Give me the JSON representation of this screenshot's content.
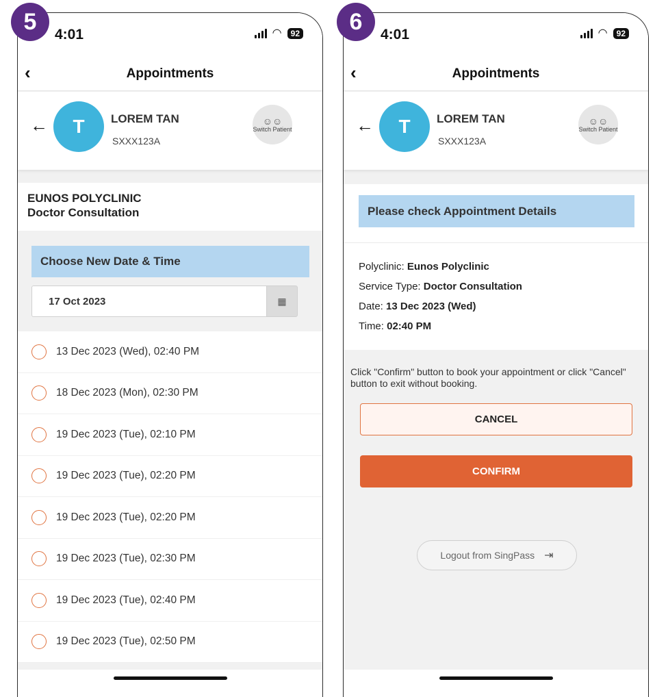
{
  "screens": [
    {
      "step": "5",
      "status": {
        "time": "4:01",
        "battery": "92"
      },
      "nav": {
        "title": "Appointments"
      },
      "patient": {
        "initial": "T",
        "name": "LOREM TAN",
        "id": "SXXX123A",
        "switch_label": "Switch Patient"
      },
      "clinic": {
        "name": "EUNOS POLYCLINIC",
        "service": "Doctor Consultation"
      },
      "choose": {
        "title": "Choose New Date & Time",
        "date_value": "17 Oct 2023"
      },
      "slots": [
        "13 Dec 2023 (Wed), 02:40 PM",
        "18 Dec 2023 (Mon), 02:30 PM",
        "19 Dec 2023 (Tue), 02:10 PM",
        "19 Dec 2023 (Tue), 02:20 PM",
        "19 Dec 2023 (Tue), 02:20 PM",
        "19 Dec 2023 (Tue), 02:30 PM",
        "19 Dec 2023 (Tue), 02:40 PM",
        "19 Dec 2023 (Tue), 02:50 PM"
      ]
    },
    {
      "step": "6",
      "status": {
        "time": "4:01",
        "battery": "92"
      },
      "nav": {
        "title": "Appointments"
      },
      "patient": {
        "initial": "T",
        "name": "LOREM TAN",
        "id": "SXXX123A",
        "switch_label": "Switch Patient"
      },
      "details": {
        "title": "Please check Appointment Details",
        "polyclinic_label": "Polyclinic:",
        "polyclinic_value": "Eunos Polyclinic",
        "service_label": "Service Type:",
        "service_value": "Doctor Consultation",
        "date_label": "Date:",
        "date_value": "13 Dec 2023 (Wed)",
        "time_label": "Time:",
        "time_value": "02:40 PM"
      },
      "instruction": "Click \"Confirm\" button to book your appointment or click \"Cancel\" button to exit without booking.",
      "cancel_label": "CANCEL",
      "confirm_label": "CONFIRM",
      "logout_label": "Logout from SingPass"
    }
  ],
  "colors": {
    "badge": "#5b2d86",
    "avatar": "#3fb4dc",
    "banner": "#b4d6f0",
    "accent": "#e06334"
  }
}
